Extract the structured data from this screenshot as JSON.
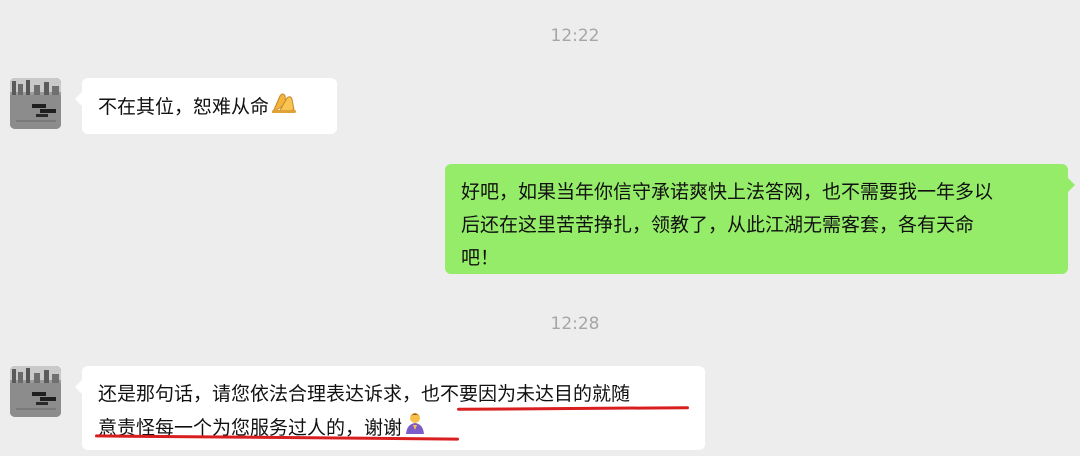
{
  "chat": {
    "time_1": "12:22",
    "time_2": "12:28",
    "messages": [
      {
        "side": "incoming",
        "lines": [
          "不在其位，恕难从命"
        ],
        "emoji": "folded-hands"
      },
      {
        "side": "outgoing",
        "lines": [
          "好吧，如果当年你信守承诺爽快上法答网，也不需要我一年多以",
          "后还在这里苦苦挣扎，领教了，从此江湖无需客套，各有天命",
          "吧！"
        ]
      },
      {
        "side": "incoming",
        "lines": [
          "还是那句话，请您依法合理表达诉求，也不要因为未达目的就随",
          "意责怪每一个为您服务过人的，谢谢"
        ],
        "emoji": "person-bowing",
        "annotation": "red-underline"
      }
    ]
  },
  "colors": {
    "background": "#ededed",
    "incoming_bubble": "#ffffff",
    "outgoing_bubble": "#95ec69",
    "timestamp": "#a6a6a6",
    "annotation": "#d81e1e"
  }
}
